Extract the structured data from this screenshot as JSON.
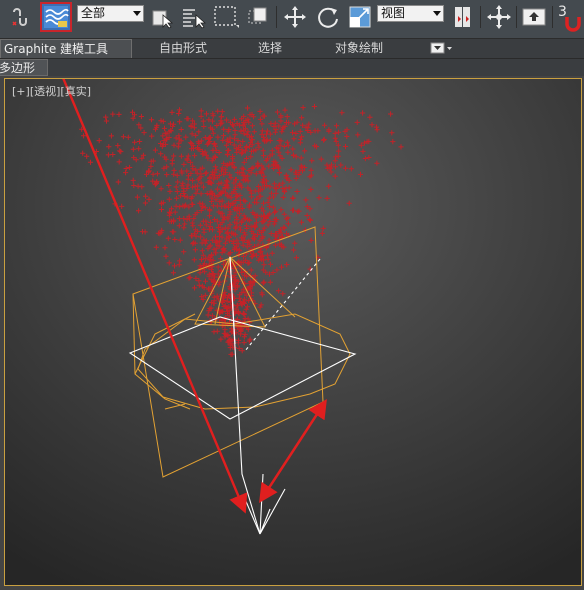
{
  "toolbar": {
    "selection_filter": "全部",
    "reference_coordinate": "视图",
    "snap_value": "3",
    "colors": {
      "highlight_border": "#c8252b",
      "dropdown_bg": "#f2f2f2"
    },
    "icons": [
      "undo-link-icon",
      "bind-spacewarp-icon",
      "select-object-icon",
      "select-by-name-icon",
      "rectangular-selection-icon",
      "window-crossing-icon",
      "move-icon",
      "rotate-icon",
      "scale-icon",
      "pivot-icon",
      "manipulate-icon",
      "keyboard-shortcut-icon",
      "snap-toggle-icon",
      "magnet-icon"
    ]
  },
  "ribbon": {
    "tabs": [
      {
        "label": "Graphite 建模工具",
        "active": true
      },
      {
        "label": "自由形式",
        "active": false
      },
      {
        "label": "选择",
        "active": false
      },
      {
        "label": "对象绘制",
        "active": false
      }
    ],
    "subtab": "多边形建模"
  },
  "viewport": {
    "label_plus": "[+]",
    "label_view": "[透视]",
    "label_shading": "[真实]",
    "border_color": "#c9a040",
    "particles_color": "#c42228",
    "gizmo_color": "#e3a233",
    "annotation_color": "#e01f1f"
  }
}
